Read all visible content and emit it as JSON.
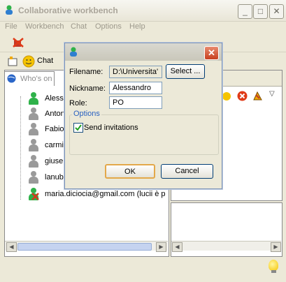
{
  "window": {
    "title": "Collaborative workbench"
  },
  "menu": [
    "File",
    "Workbench",
    "Chat",
    "Options",
    "Help"
  ],
  "toolbar": {
    "chat_label": "Chat"
  },
  "left_tab": {
    "label": "Who's on"
  },
  "users": [
    {
      "name": "Alessandro",
      "status": "online"
    },
    {
      "name": "Antonio",
      "status": "offline"
    },
    {
      "name": "Fabio",
      "status": "offline"
    },
    {
      "name": "carmine",
      "status": "offline"
    },
    {
      "name": "giuseppe",
      "status": "offline"
    },
    {
      "name": "lanub",
      "status": "offline"
    },
    {
      "name": "maria.diciocia@gmail.com (lucii è pe",
      "status": "away"
    }
  ],
  "dialog": {
    "filename_label": "Filename:",
    "filename_value": "D:\\Universita'",
    "select_button": "Select ...",
    "nickname_label": "Nickname:",
    "nickname_value": "Alessandro",
    "role_label": "Role:",
    "role_value": "PO",
    "options_legend": "Options",
    "send_invitations_label": "Send invitations",
    "send_invitations_checked": true,
    "ok_button": "OK",
    "cancel_button": "Cancel"
  },
  "colors": {
    "online": "#2fb24a",
    "offline": "#9a9a9a",
    "away_badge": "#d23a1e",
    "accent": "#003c74"
  }
}
